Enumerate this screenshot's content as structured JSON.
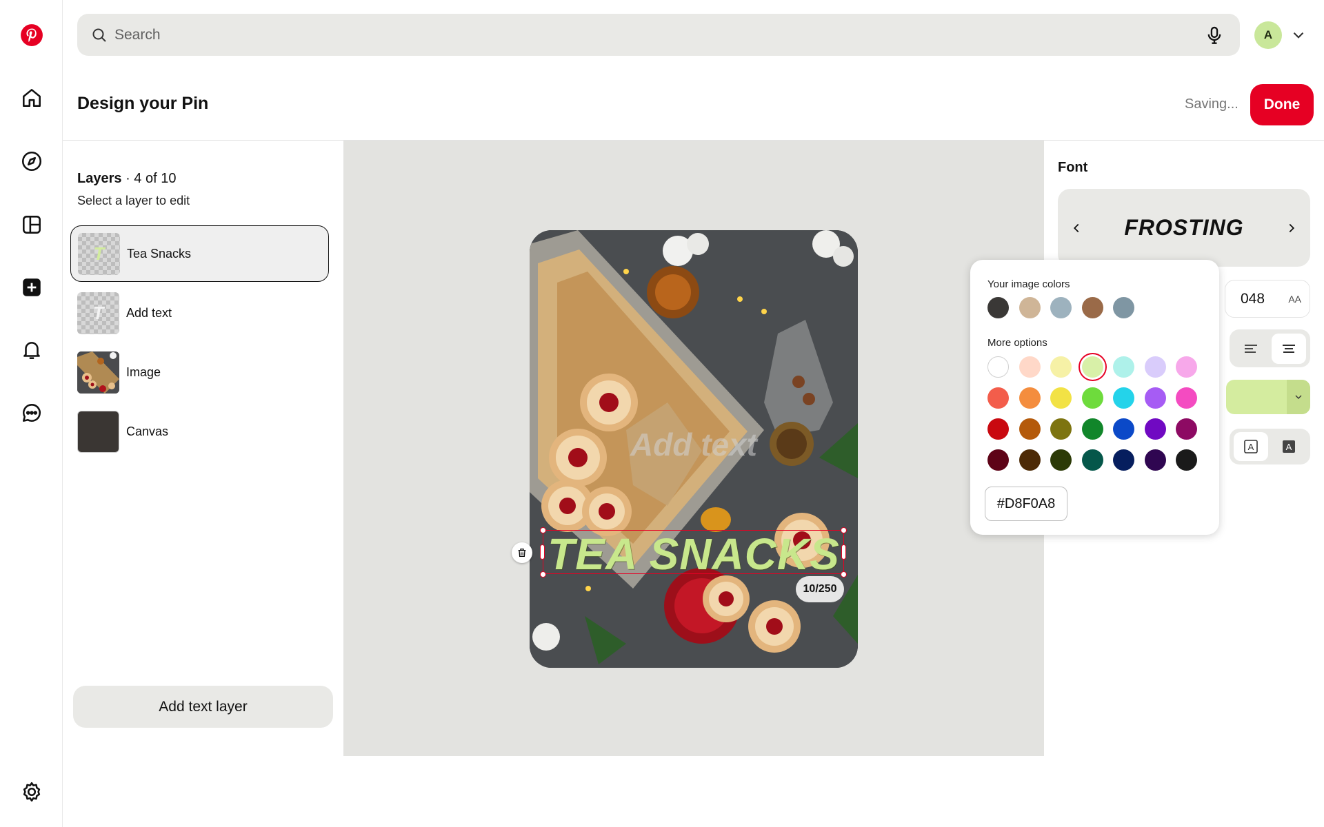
{
  "search": {
    "placeholder": "Search"
  },
  "user": {
    "avatar_initial": "A"
  },
  "header": {
    "title": "Design your Pin",
    "status": "Saving...",
    "done_label": "Done"
  },
  "layers": {
    "title": "Layers",
    "count": "· 4 of 10",
    "subtitle": "Select a layer to edit",
    "items": [
      {
        "label": "Tea Snacks",
        "thumb": "T"
      },
      {
        "label": "Add text",
        "thumb": "T"
      },
      {
        "label": "Image"
      },
      {
        "label": "Canvas"
      }
    ],
    "add_button": "Add text layer"
  },
  "pin": {
    "placeholder_text": "Add text",
    "selected_text": "TEA SNACKS",
    "char_count": "10/250"
  },
  "font_panel": {
    "title": "Font",
    "font_name": "FROSTING",
    "size": "048",
    "size_icon": "AA",
    "text_color": "#D4EC9F"
  },
  "color_popover": {
    "image_colors_label": "Your image colors",
    "image_colors": [
      "#3A3836",
      "#CFB597",
      "#9DB2BE",
      "#9A6A48",
      "#7F96A3"
    ],
    "more_label": "More options",
    "more_colors": [
      [
        "#FFFFFF",
        "#FFD8C8",
        "#F6F1A6",
        "#D8F0A8",
        "#AEF1EA",
        "#D9CCFB",
        "#F7A8EA"
      ],
      [
        "#F35D4B",
        "#F48D3E",
        "#F2E245",
        "#6EDB3C",
        "#24D3EA",
        "#A65CF4",
        "#F44BC1"
      ],
      [
        "#C90910",
        "#B45A0B",
        "#7D7410",
        "#11862A",
        "#0B49C8",
        "#7009C2",
        "#8D0A63"
      ],
      [
        "#5E0317",
        "#4D2A06",
        "#2C3A07",
        "#05574A",
        "#061E5E",
        "#2F0651",
        "#1A1A1A"
      ]
    ],
    "selected_hex": "#D8F0A8"
  },
  "colors": {
    "brand": "#E60023"
  }
}
